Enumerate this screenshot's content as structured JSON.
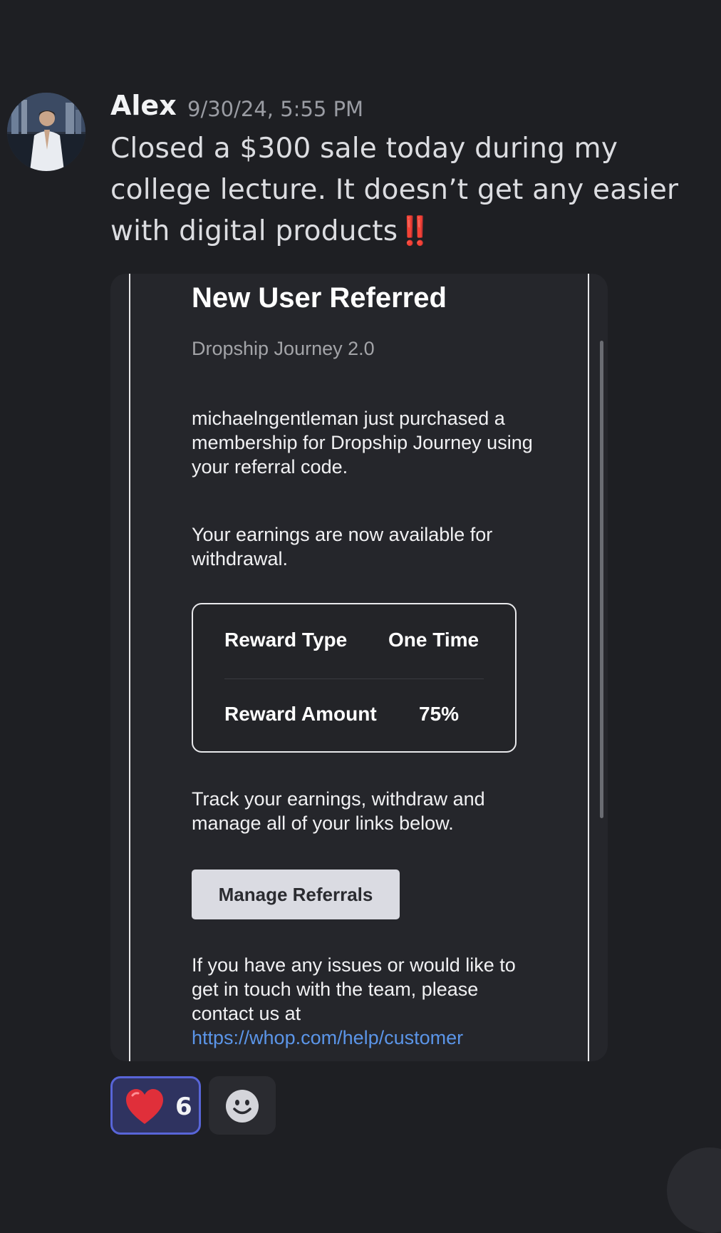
{
  "message": {
    "author": "Alex",
    "timestamp": "9/30/24, 5:55 PM",
    "text": "Closed a $300 sale today during my college lecture. It doesn’t get any easier with digital products",
    "text_emoji": "‼️"
  },
  "embed": {
    "title": "New User Referred",
    "subtitle": "Dropship Journey 2.0",
    "paragraph1": "michaelngentleman just purchased a membership for Dropship Journey using your referral code.",
    "paragraph2": "Your earnings are now available for withdrawal.",
    "reward": {
      "type_label": "Reward Type",
      "type_value": "One Time",
      "amount_label": "Reward Amount",
      "amount_value": "75%"
    },
    "paragraph3": "Track your earnings, withdraw and manage all of your links below.",
    "button_label": "Manage Referrals",
    "paragraph4": "If you have any issues or would like to get in touch with the team, please contact us at",
    "help_link": "https://whop.com/help/customer"
  },
  "reactions": [
    {
      "emoji": "heart-icon",
      "count": "6",
      "selected": true
    },
    {
      "emoji": "add-reaction-icon"
    }
  ],
  "colors": {
    "background": "#1e1f23",
    "embed_bg": "#25262b",
    "link": "#5b95e8",
    "reaction_selected_bg": "#2f3360",
    "reaction_selected_border": "#5865d8",
    "alert_red": "#e0312c"
  }
}
